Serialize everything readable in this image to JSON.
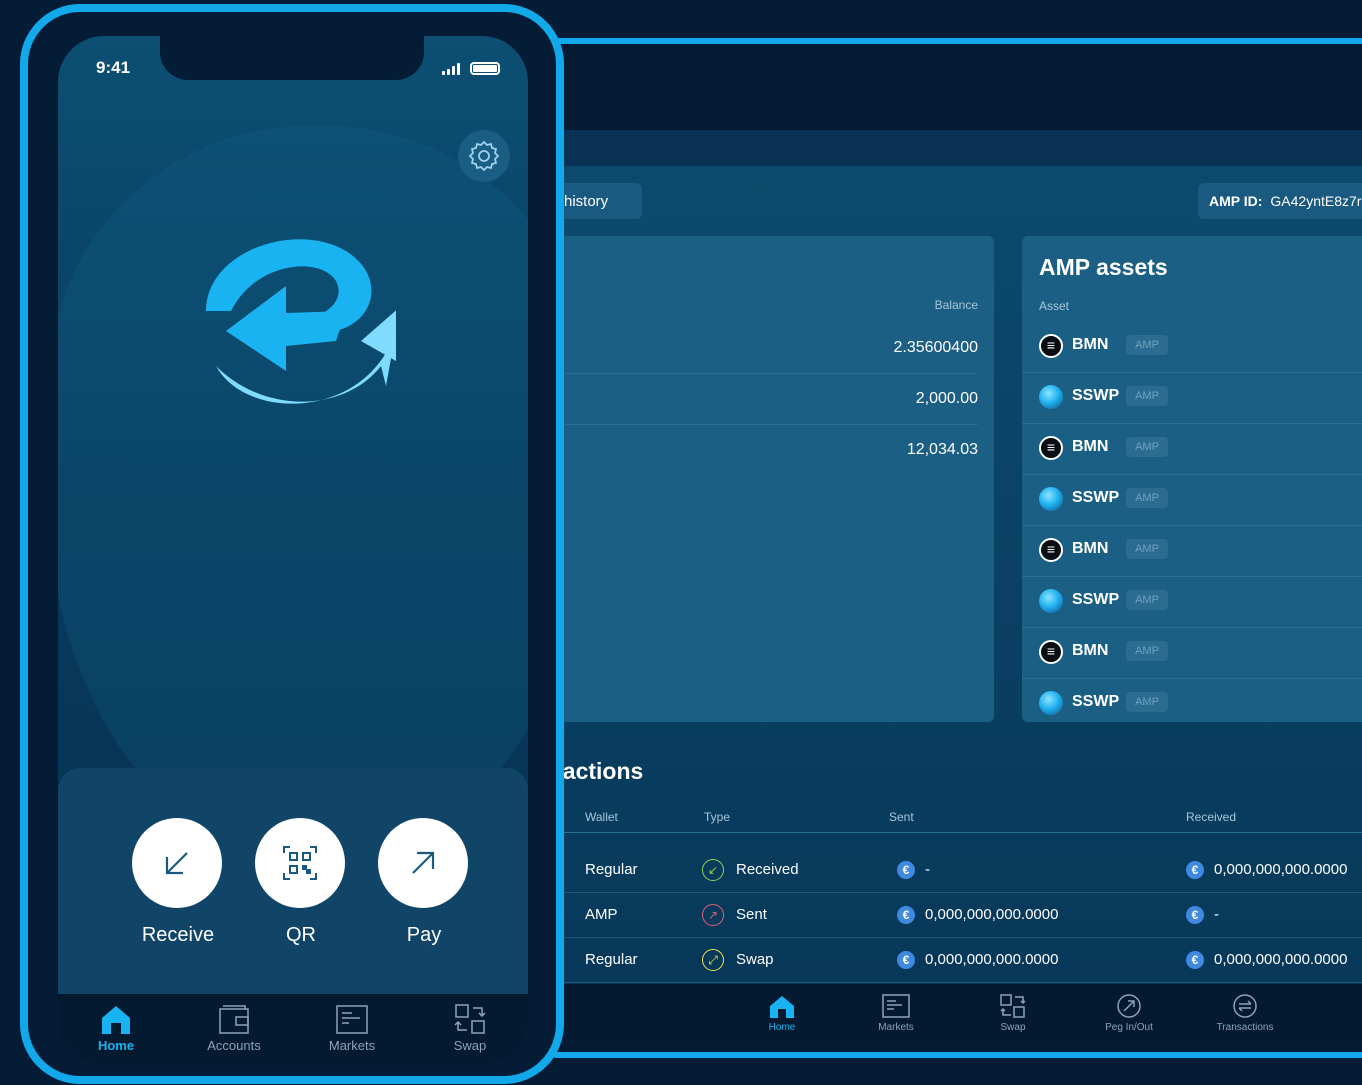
{
  "tablet": {
    "history_label": "history",
    "amp_id_label": "AMP ID:",
    "amp_id_value": "GA42yntE8z7r",
    "balance": {
      "header": "Balance",
      "rows": [
        "2.35600400",
        "2,000.00",
        "12,034.03"
      ]
    },
    "amp_assets": {
      "title": "AMP assets",
      "header": "Asset",
      "badge": "AMP",
      "items": [
        {
          "name": "BMN",
          "icon": "bmn-icon"
        },
        {
          "name": "SSWP",
          "icon": "sswp-icon"
        },
        {
          "name": "BMN",
          "icon": "bmn-icon"
        },
        {
          "name": "SSWP",
          "icon": "sswp-icon"
        },
        {
          "name": "BMN",
          "icon": "bmn-icon"
        },
        {
          "name": "SSWP",
          "icon": "sswp-icon"
        },
        {
          "name": "BMN",
          "icon": "bmn-icon"
        },
        {
          "name": "SSWP",
          "icon": "sswp-icon"
        }
      ]
    },
    "transactions": {
      "title": "sactions",
      "columns": [
        "Wallet",
        "Type",
        "Sent",
        "Received"
      ],
      "rows": [
        {
          "wallet": "Regular",
          "type": "Received",
          "sent": "-",
          "received": "0,000,000,000.0000",
          "type_color": "#7ed957",
          "type_glyph": "↙"
        },
        {
          "wallet": "AMP",
          "type": "Sent",
          "sent": "0,000,000,000.0000",
          "received": "-",
          "type_color": "#e0607a",
          "type_glyph": "↗"
        },
        {
          "wallet": "Regular",
          "type": "Swap",
          "sent": "0,000,000,000.0000",
          "received": "0,000,000,000.0000",
          "type_color": "#f2e14b",
          "type_glyph": "⤢"
        }
      ]
    },
    "nav": [
      "Home",
      "Markets",
      "Swap",
      "Peg In/Out",
      "Transactions"
    ]
  },
  "phone": {
    "time": "9:41",
    "actions": {
      "receive": "Receive",
      "qr": "QR",
      "pay": "Pay"
    },
    "nav": [
      "Home",
      "Accounts",
      "Markets",
      "Swap"
    ]
  },
  "colors": {
    "accent": "#12a9ea",
    "active_nav": "#19b3f2",
    "card": "#1c5f84"
  }
}
